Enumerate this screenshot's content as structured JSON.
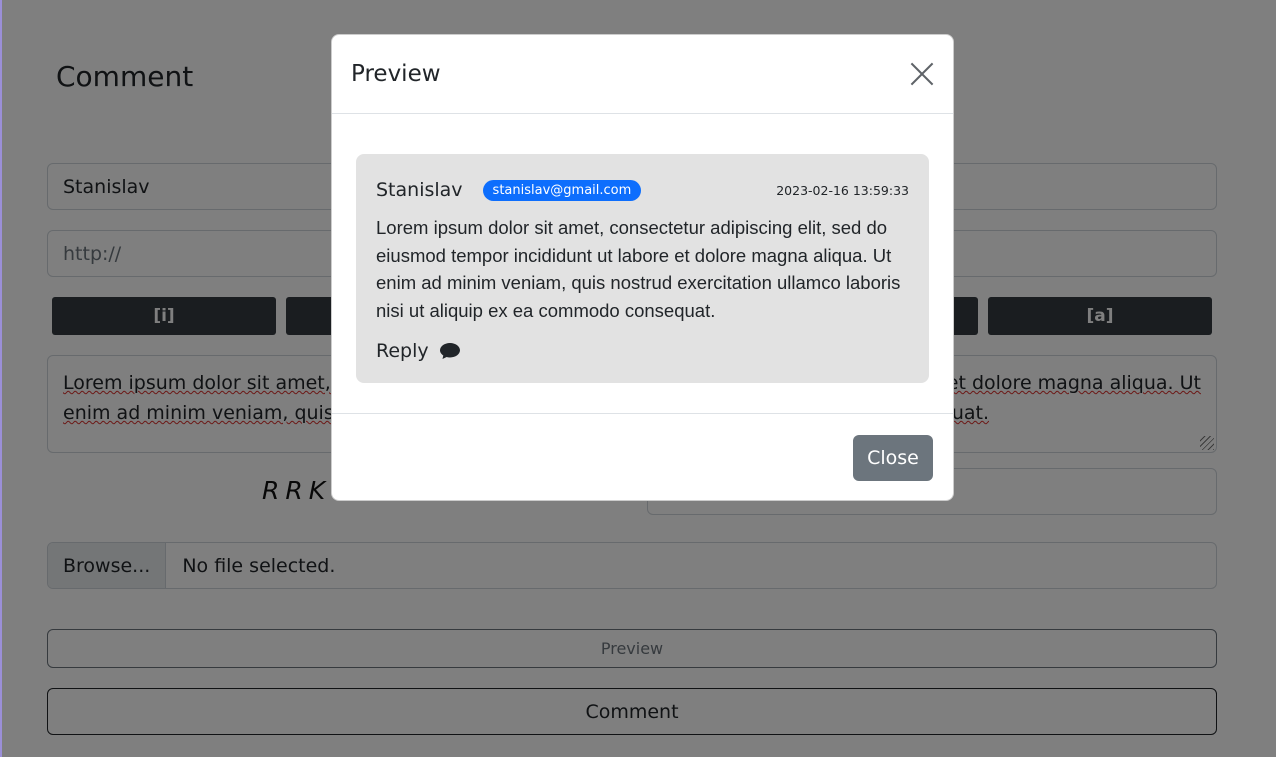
{
  "form": {
    "title": "Comment",
    "name_value": "Stanislav",
    "url_placeholder": "http://",
    "bbcode_buttons": [
      "[i]",
      "",
      "",
      "",
      "[a]"
    ],
    "message_lines": [
      "Lorem ipsum dolor sit amet, co",
      "et dolore magna aliqua. Ut",
      "enim ad minim veniam, quis no",
      "equat."
    ],
    "captcha_text": "RRKC",
    "file_browse_label": "Browse...",
    "file_status": "No file selected.",
    "preview_button": "Preview",
    "comment_button": "Comment"
  },
  "modal": {
    "title": "Preview",
    "close_icon": "close-icon",
    "author": "Stanislav",
    "email": "stanislav@gmail.com",
    "timestamp": "2023-02-16 13:59:33",
    "text_lines": [
      "Lorem ipsum dolor sit amet, consectetur adipiscing elit, sed do",
      "eiusmod tempor incididunt ut labore et dolore magna aliqua. Ut",
      "enim ad minim veniam, quis nostrud exercitation ullamco laboris",
      "nisi ut aliquip ex ea commodo consequat."
    ],
    "reply_label": "Reply",
    "reply_icon": "speech-bubble-icon",
    "close_button": "Close"
  },
  "colors": {
    "badge": "#0d6efd",
    "secondary": "#6c757d",
    "dark": "#343a40",
    "card_bg": "#e2e2e2"
  }
}
